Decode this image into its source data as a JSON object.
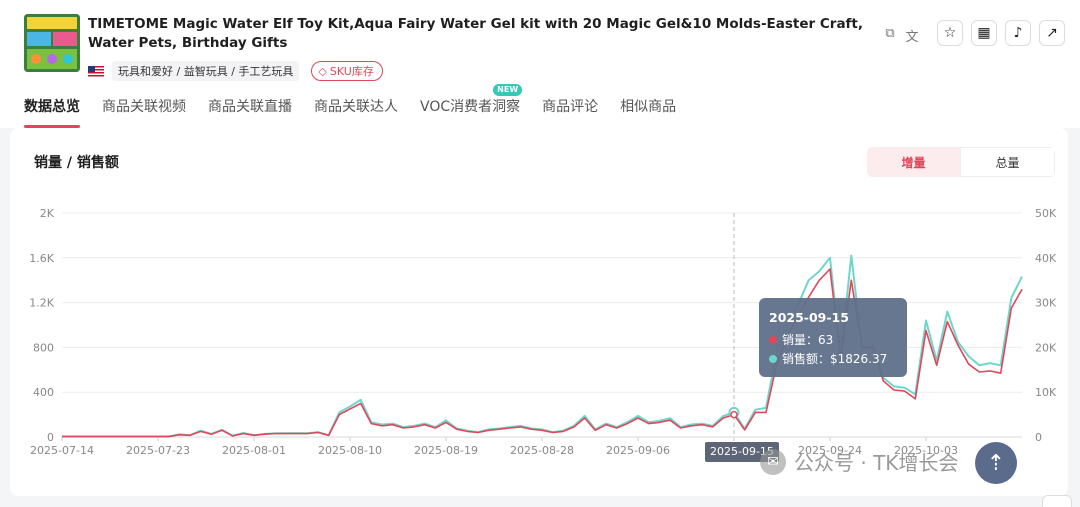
{
  "product": {
    "title": "TIMETOME Magic Water Elf Toy Kit,Aqua Fairy Water Gel kit with 20 Magic Gel&10 Molds-Easter Craft, Water Pets, Birthday Gifts",
    "category": "玩具和爱好 / 益智玩具 / 手工艺玩具",
    "sku_label": "SKU库存"
  },
  "header_icons": [
    "copy-icon",
    "translate-icon"
  ],
  "actions": [
    "star-icon",
    "qrcode-icon",
    "tiktok-icon",
    "external-link-icon"
  ],
  "tabs": [
    {
      "label": "数据总览",
      "active": true
    },
    {
      "label": "商品关联视频"
    },
    {
      "label": "商品关联直播"
    },
    {
      "label": "商品关联达人"
    },
    {
      "label": "VOC消费者洞察",
      "badge": "NEW"
    },
    {
      "label": "商品评论"
    },
    {
      "label": "相似商品"
    }
  ],
  "section": {
    "title": "销量 / 销售额",
    "toggle": {
      "increment": "增量",
      "total": "总量"
    }
  },
  "colors": {
    "accent": "#e0475b",
    "sales": "#e0475b",
    "revenue": "#6fd6cc",
    "tooltip_bg": "#60708a"
  },
  "chart_data": {
    "type": "line",
    "x_labels": [
      "2025-07-14",
      "2025-07-23",
      "2025-08-01",
      "2025-08-10",
      "2025-08-19",
      "2025-08-28",
      "2025-09-06",
      "2025-09-15",
      "2025-09-24",
      "2025-10-03"
    ],
    "y_left": {
      "ticks": [
        "0",
        "400",
        "800",
        "1.2K",
        "1.6K",
        "2K"
      ],
      "max": 2000
    },
    "y_right": {
      "ticks": [
        "0",
        "10K",
        "20K",
        "30K",
        "40K",
        "50K"
      ],
      "max": 50000
    },
    "series": [
      {
        "name": "销量",
        "axis": "left",
        "values": [
          5,
          5,
          5,
          5,
          5,
          5,
          5,
          5,
          5,
          5,
          5,
          20,
          15,
          50,
          25,
          60,
          10,
          30,
          15,
          25,
          30,
          30,
          30,
          30,
          40,
          15,
          200,
          250,
          300,
          120,
          100,
          110,
          80,
          90,
          110,
          80,
          130,
          70,
          50,
          40,
          60,
          70,
          80,
          90,
          70,
          60,
          40,
          50,
          90,
          170,
          60,
          110,
          80,
          120,
          170,
          120,
          130,
          150,
          80,
          100,
          110,
          90,
          170,
          200,
          63,
          220,
          220,
          650,
          900,
          1080,
          1250,
          1400,
          1500,
          700,
          1400,
          800,
          800,
          500,
          420,
          410,
          340,
          950,
          640,
          1030,
          820,
          650,
          580,
          590,
          570,
          1150,
          1320
        ]
      },
      {
        "name": "销售额",
        "axis": "right",
        "values": [
          100,
          100,
          100,
          100,
          100,
          100,
          100,
          100,
          100,
          100,
          100,
          600,
          400,
          1400,
          700,
          1600,
          300,
          900,
          400,
          700,
          800,
          850,
          850,
          850,
          1100,
          400,
          5500,
          6800,
          8300,
          3300,
          2800,
          3000,
          2200,
          2500,
          3000,
          2200,
          3700,
          1900,
          1400,
          1100,
          1700,
          1900,
          2200,
          2500,
          1900,
          1700,
          1100,
          1400,
          2500,
          4700,
          1700,
          3000,
          2200,
          3300,
          4700,
          3300,
          3600,
          4200,
          2200,
          2800,
          3000,
          2500,
          4700,
          5500,
          1826.37,
          6100,
          6500,
          18900,
          25000,
          29500,
          35000,
          37000,
          40000,
          18000,
          40500,
          20000,
          21000,
          13200,
          11300,
          11000,
          9500,
          26000,
          17000,
          28000,
          21200,
          18000,
          16000,
          16500,
          16000,
          31000,
          35800
        ]
      }
    ],
    "highlight": {
      "label": "2025-09-15",
      "sales": "63",
      "revenue": "$1826.37"
    }
  },
  "tooltip": {
    "date": "2025-09-15",
    "sales_label": "销量：63",
    "revenue_label": "销售额：$1826.37"
  },
  "watermark": {
    "text": "公众号 · TK增长会"
  }
}
